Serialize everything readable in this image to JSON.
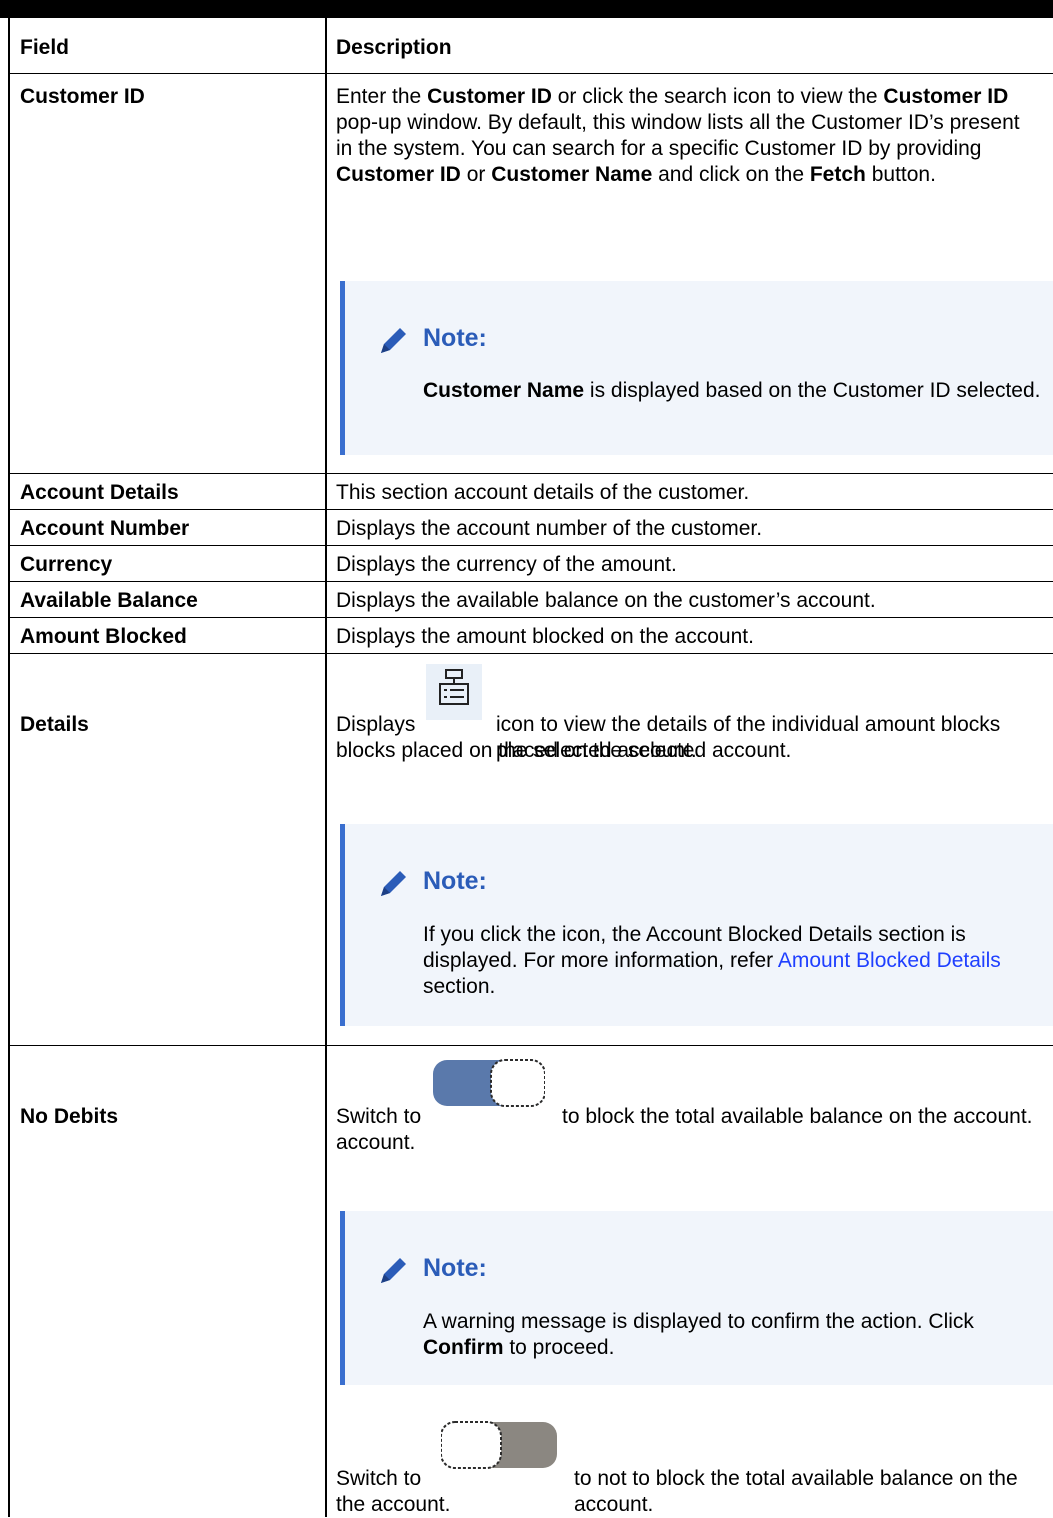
{
  "table": {
    "headers": {
      "field": "Field",
      "description": "Description"
    },
    "rows": [
      {
        "field": "Customer ID",
        "desc_parts": [
          "Enter the ",
          "Customer ID",
          " or click the search icon to view the ",
          "Customer ID",
          " pop-up window. By default, this window lists all the Customer ID’s present in the system. You can search for a specific Customer ID by providing ",
          "Customer ID",
          " or ",
          "Customer Name",
          " and click on the ",
          "Fetch",
          " button."
        ],
        "note": {
          "title": "Note:",
          "bold": "Customer Name",
          "text": " is displayed based on the Customer ID selected."
        }
      },
      {
        "field": "Account Details",
        "desc": "This section account details of the customer."
      },
      {
        "field": "Account Number",
        "desc": "Displays the account number of the customer."
      },
      {
        "field": "Currency",
        "desc": "Displays the currency of the amount."
      },
      {
        "field": "Available Balance",
        "desc": "Displays the available balance on the customer’s account."
      },
      {
        "field": "Amount Blocked",
        "desc": "Displays the amount blocked on the account."
      },
      {
        "field": "Details",
        "desc_before": "Displays ",
        "desc_after": " icon to view the details of the individual amount blocks placed on the selected account.",
        "icon": "details-list-icon",
        "note": {
          "title": "Note:",
          "text": "If you click the icon, the Account Blocked Details section is displayed. For more information, refer ",
          "link": "Amount Blocked Details",
          "text_after": " section."
        }
      },
      {
        "field": "No Debits",
        "desc1_before": "Switch to ",
        "desc1_after": " to block the total available balance on the account.",
        "note": {
          "title": "Note:",
          "text": "A warning message is displayed to confirm the action. Click ",
          "bold": "Confirm",
          "text_after": " to proceed."
        },
        "desc2_before": "Switch to ",
        "desc2_after": " to not to block the total available balance on the account."
      }
    ]
  },
  "colors": {
    "note_bg": "#f1f5fb",
    "note_bar": "#3a6fcf",
    "note_title": "#2b5cb8",
    "link": "#1f3fff",
    "toggle_on": "#5a79ab",
    "toggle_off": "#8b8781"
  }
}
